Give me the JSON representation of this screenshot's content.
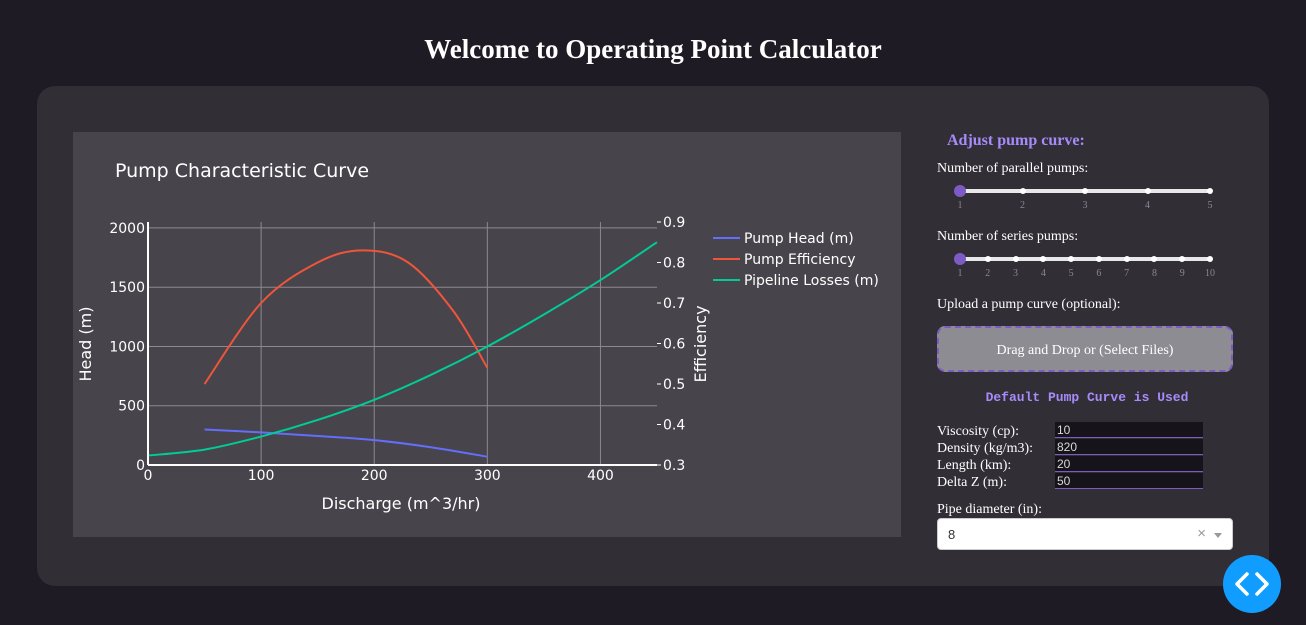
{
  "page": {
    "title": "Welcome to Operating Point Calculator"
  },
  "chart_data": {
    "type": "line",
    "title": "Pump Characteristic Curve",
    "xlabel": "Discharge (m^3/hr)",
    "ylabel": "Head (m)",
    "y2label": "Efficiency",
    "xlim": [
      0,
      450
    ],
    "ylim": [
      0,
      2050
    ],
    "y2lim": [
      0.3,
      0.9
    ],
    "x_ticks": [
      "0",
      "100",
      "200",
      "300",
      "400"
    ],
    "y_ticks": [
      "0",
      "500",
      "1000",
      "1500",
      "2000"
    ],
    "y2_ticks": [
      "0.3",
      "0.4",
      "0.5",
      "0.6",
      "0.7",
      "0.8",
      "0.9"
    ],
    "legend_position": "right",
    "grid": true,
    "series": [
      {
        "name": "Pump Head (m)",
        "axis": "y",
        "color": "#636efa",
        "x": [
          50,
          100,
          150,
          200,
          250,
          300
        ],
        "y": [
          300,
          275,
          245,
          210,
          150,
          70
        ]
      },
      {
        "name": "Pump Efficiency",
        "axis": "y2",
        "color": "#ef553b",
        "x": [
          50,
          100,
          150,
          190,
          230,
          270,
          300
        ],
        "y": [
          0.5,
          0.7,
          0.8,
          0.83,
          0.8,
          0.68,
          0.54
        ]
      },
      {
        "name": "Pipeline Losses (m)",
        "axis": "y",
        "color": "#00cc96",
        "x": [
          0,
          50,
          100,
          150,
          200,
          250,
          300,
          350,
          400,
          450
        ],
        "y": [
          80,
          130,
          240,
          380,
          550,
          760,
          1000,
          1270,
          1560,
          1880
        ]
      }
    ]
  },
  "controls": {
    "heading": "Adjust pump curve:",
    "parallel_label": "Number of parallel pumps:",
    "parallel_marks": [
      "1",
      "2",
      "3",
      "4",
      "5"
    ],
    "parallel_value": 1,
    "series_label": "Number of series pumps:",
    "series_marks": [
      "1",
      "2",
      "3",
      "4",
      "5",
      "6",
      "7",
      "8",
      "9",
      "10"
    ],
    "series_value": 1,
    "upload_label": "Upload a pump curve (optional):",
    "upload_text": "Drag and Drop or (Select Files)",
    "status": "Default Pump Curve is Used",
    "viscosity_label": "Viscosity (cp):",
    "viscosity_value": "10",
    "density_label": "Density (kg/m3):",
    "density_value": "820",
    "length_label": "Length (km):",
    "length_value": "20",
    "deltaz_label": "Delta Z (m):",
    "deltaz_value": "50",
    "diameter_label": "Pipe diameter (in):",
    "diameter_value": "8",
    "clear_symbol": "×"
  },
  "fab": {
    "icon": "code-icon",
    "color": "#119dff"
  }
}
